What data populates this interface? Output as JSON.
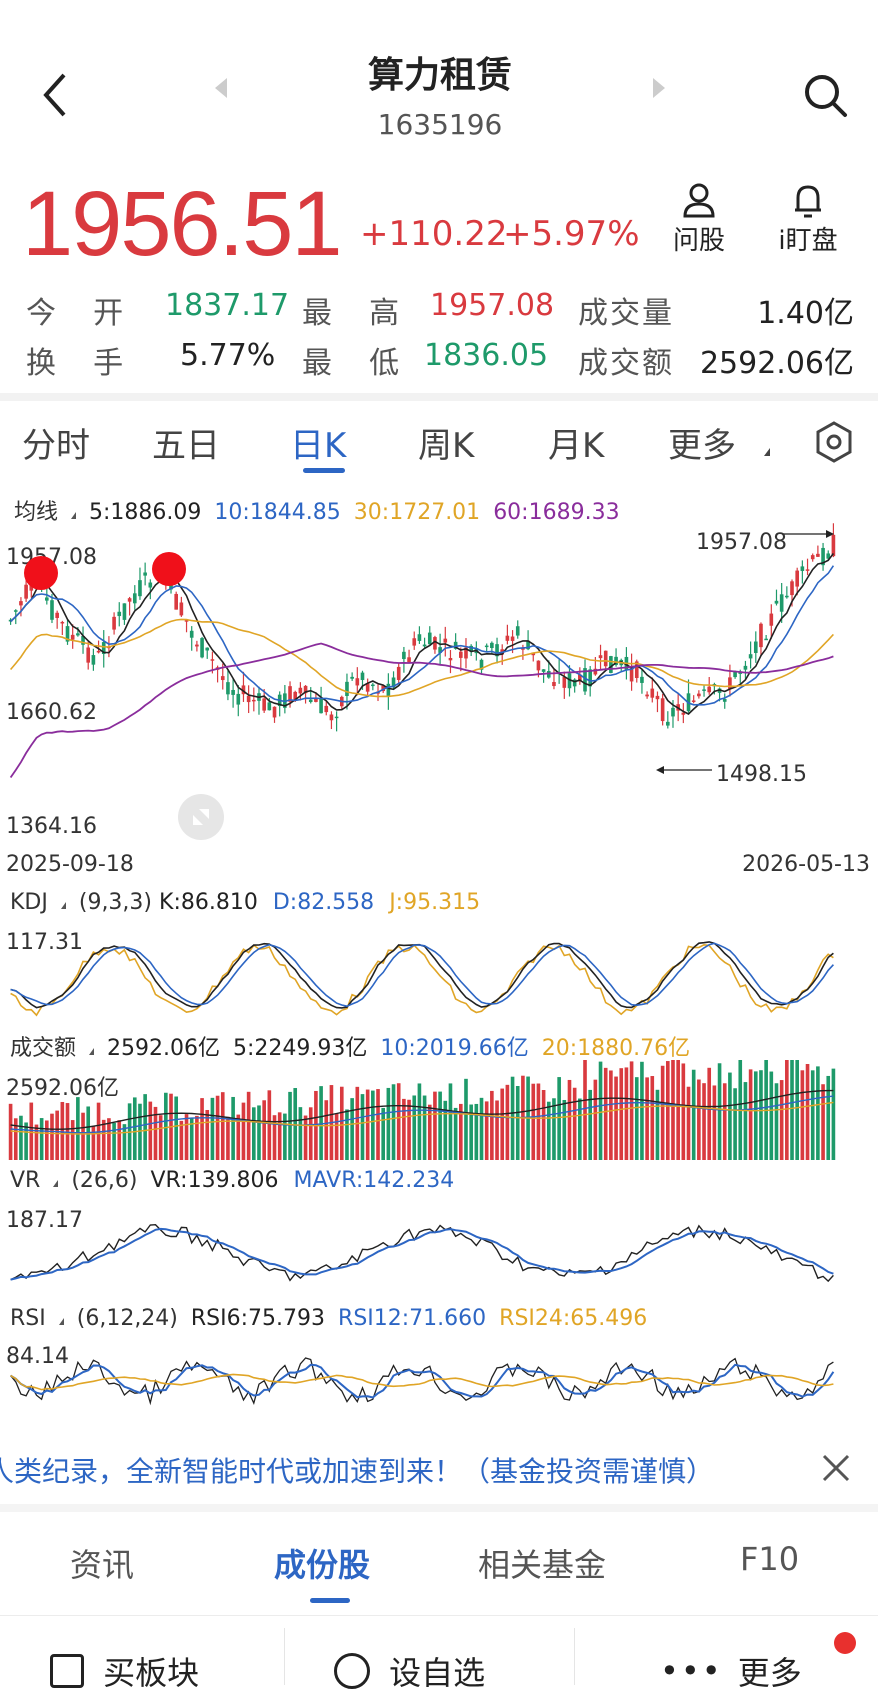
{
  "header": {
    "back_icon": "chevron-left-icon",
    "title": "算力租赁",
    "code": "1635196",
    "search_icon": "search-icon"
  },
  "quote": {
    "price": "1956.51",
    "change": "+110.22",
    "change_pct": "+5.97%",
    "ask_label": "问股",
    "watch_label": "i盯盘",
    "ask_icon": "person-icon",
    "watch_icon": "bell-icon"
  },
  "stats": {
    "open_label": "今  开",
    "open": "1837.17",
    "high_label": "最  高",
    "high": "1957.08",
    "volume_label": "成交量",
    "volume": "1.40亿",
    "turnover_label": "换  手",
    "turnover": "5.77%",
    "low_label": "最  低",
    "low": "1836.05",
    "amount_label": "成交额",
    "amount": "2592.06亿"
  },
  "tabs": [
    {
      "label": "分时"
    },
    {
      "label": "五日"
    },
    {
      "label": "日K"
    },
    {
      "label": "周K"
    },
    {
      "label": "月K"
    },
    {
      "label": "更多"
    }
  ],
  "active_tab": "日K",
  "settings_icon": "hexagon-settings-icon",
  "ma": {
    "label": "均线",
    "ma5": "5:1886.09",
    "ma10": "10:1844.85",
    "ma30": "30:1727.01",
    "ma60": "60:1689.33"
  },
  "kline": {
    "y_top": "1957.08",
    "y_mid": "1660.62",
    "y_bottom": "1364.16",
    "date_start": "2025-09-18",
    "date_end": "2026-05-13",
    "max_mark": "1957.08",
    "min_mark": "1498.15"
  },
  "kdj": {
    "label": "KDJ",
    "params": "(9,3,3)",
    "k": "K:86.810",
    "d": "D:82.558",
    "j": "J:95.315",
    "y_top": "117.31"
  },
  "amount_panel": {
    "label": "成交额",
    "value": "2592.06亿",
    "ma5": "5:2249.93亿",
    "ma10": "10:2019.66亿",
    "ma20": "20:1880.76亿",
    "y_top": "2592.06亿"
  },
  "vr": {
    "label": "VR",
    "params": "(26,6)",
    "vr": "VR:139.806",
    "mavr": "MAVR:142.234",
    "y_top": "187.17"
  },
  "rsi": {
    "label": "RSI",
    "params": "(6,12,24)",
    "rsi6": "RSI6:75.793",
    "rsi12": "RSI12:71.660",
    "rsi24": "RSI24:65.496",
    "y_top": "84.14"
  },
  "ticker": {
    "text": "人类纪录，全新智能时代或加速到来！（基金投资需谨慎）",
    "close_icon": "close-icon"
  },
  "bottom_tabs": [
    {
      "label": "资讯"
    },
    {
      "label": "成份股"
    },
    {
      "label": "相关基金"
    },
    {
      "label": "F10"
    }
  ],
  "active_bottom": "成份股",
  "actions": [
    {
      "label": "买板块",
      "icon": "buy-icon"
    },
    {
      "label": "设自选",
      "icon": "add-icon"
    },
    {
      "label": "更多",
      "icon": "more-icon"
    }
  ],
  "colors": {
    "up": "#d93a3f",
    "down": "#1e9a6a",
    "accent": "#2d66c4",
    "ma5": "#222222",
    "ma10": "#2d66c4",
    "ma30": "#e0a526",
    "ma60": "#8a2d9c"
  }
}
